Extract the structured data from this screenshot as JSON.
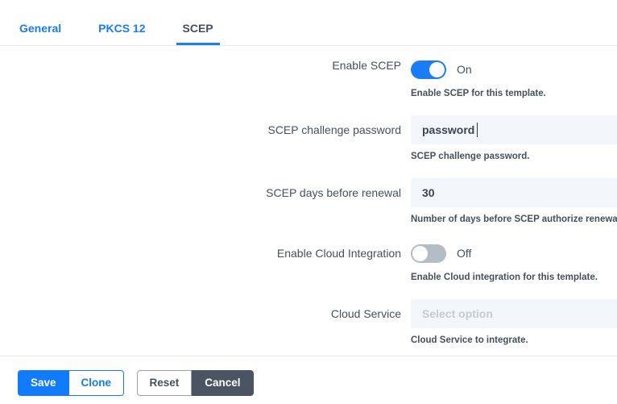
{
  "tabs": [
    {
      "label": "General",
      "active": false
    },
    {
      "label": "PKCS 12",
      "active": false
    },
    {
      "label": "SCEP",
      "active": true
    }
  ],
  "fields": {
    "enable_scep": {
      "label": "Enable SCEP",
      "state_text": "On",
      "help": "Enable SCEP for this template."
    },
    "challenge_password": {
      "label": "SCEP challenge password",
      "value": "password",
      "help": "SCEP challenge password."
    },
    "days_before_renewal": {
      "label": "SCEP days before renewal",
      "value": "30",
      "help": "Number of days before SCEP authorize renewal"
    },
    "cloud_integration": {
      "label": "Enable Cloud Integration",
      "state_text": "Off",
      "help": "Enable Cloud integration for this template."
    },
    "cloud_service": {
      "label": "Cloud Service",
      "placeholder": "Select option",
      "help": "Cloud Service to integrate."
    }
  },
  "footer": {
    "save_label": "Save",
    "clone_label": "Clone",
    "reset_label": "Reset",
    "cancel_label": "Cancel"
  },
  "colors": {
    "accent": "#127bfb",
    "toggle_on": "#1a7cf7",
    "toggle_off": "#b4bcc6",
    "text": "#45505e",
    "input_bg": "#f3f7fb",
    "cancel_bg": "#4a5463"
  }
}
